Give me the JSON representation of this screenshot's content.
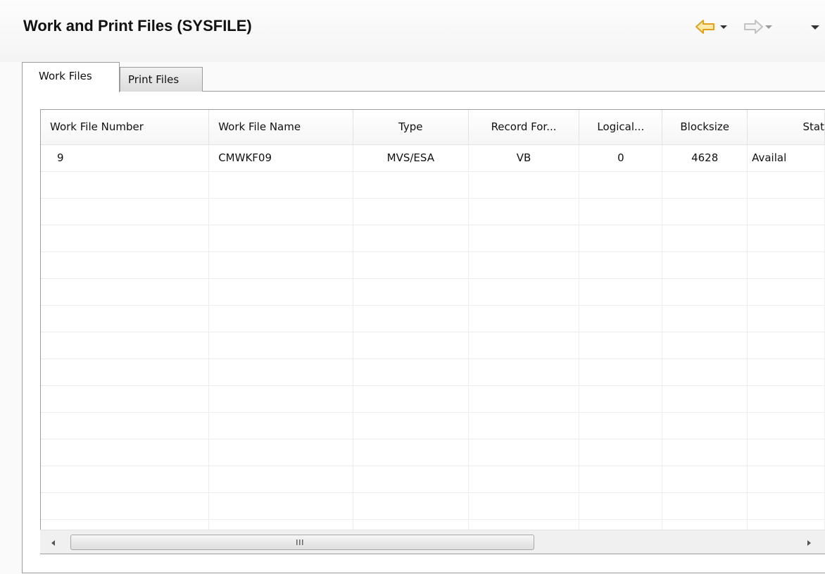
{
  "header": {
    "title": "Work and Print Files (SYSFILE)",
    "icons": {
      "back": "back-arrow-icon",
      "back_menu": "dropdown-arrow-icon",
      "forward": "forward-arrow-icon",
      "forward_menu": "dropdown-arrow-icon",
      "view_menu": "view-menu-icon"
    },
    "accent_color": "#f2b33a"
  },
  "tabs": [
    {
      "label": "Work Files",
      "selected": true
    },
    {
      "label": "Print Files",
      "selected": false
    }
  ],
  "table": {
    "columns": [
      "Work File Number",
      "Work File Name",
      "Type",
      "Record For...",
      "Logical...",
      "Blocksize",
      "Stat"
    ],
    "rows": [
      [
        "9",
        "CMWKF09",
        "MVS/ESA",
        "VB",
        "0",
        "4628",
        "Availal"
      ]
    ]
  },
  "scrollbar": {
    "grip_glyph": "III"
  }
}
